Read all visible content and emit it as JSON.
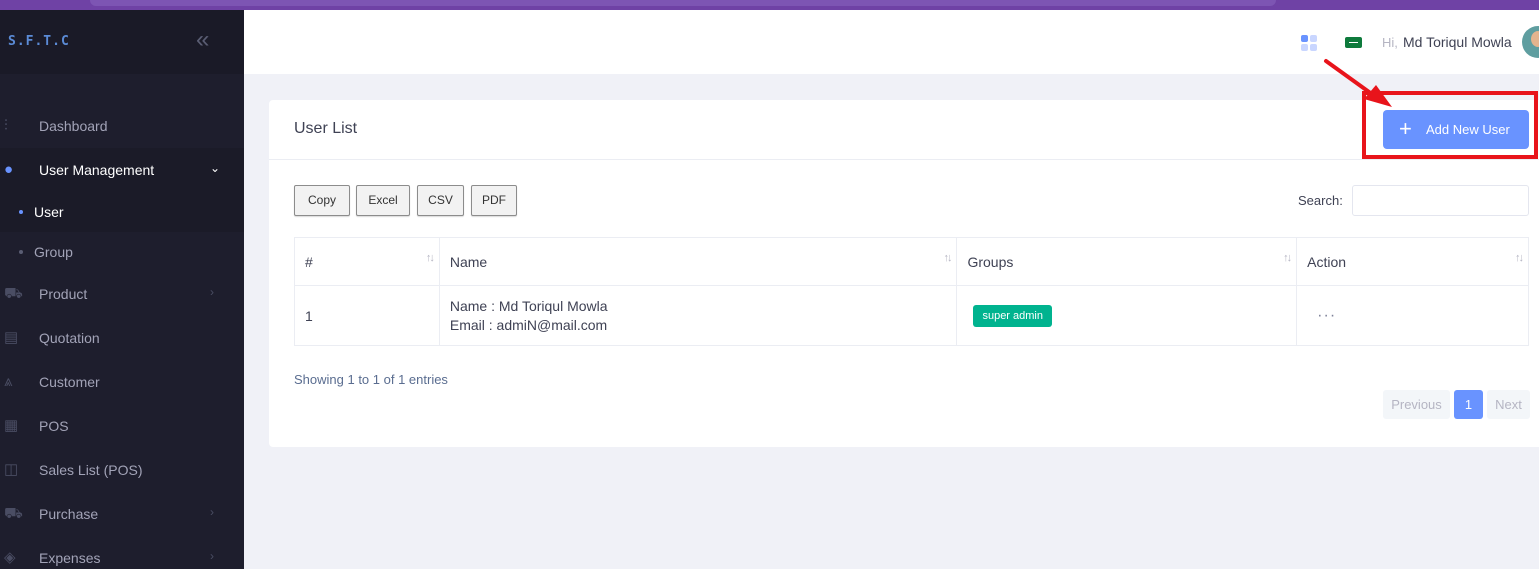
{
  "sidebar": {
    "brand": "S.F.T.C",
    "collapse_icon": "double-chevron-left-icon",
    "items": [
      {
        "label": "Dashboard",
        "icon": "sliders-icon"
      },
      {
        "label": "User Management",
        "icon": "users-icon"
      },
      {
        "label": "Product",
        "icon": "cart-icon"
      },
      {
        "label": "Quotation",
        "icon": "document-icon"
      },
      {
        "label": "Customer",
        "icon": "customer-icon"
      },
      {
        "label": "POS",
        "icon": "grid-icon"
      },
      {
        "label": "Sales List (POS)",
        "icon": "basket-icon"
      },
      {
        "label": "Purchase",
        "icon": "cart-icon"
      },
      {
        "label": "Expenses",
        "icon": "tag-icon"
      }
    ],
    "submenu": [
      {
        "label": "User"
      },
      {
        "label": "Group"
      }
    ]
  },
  "header": {
    "greeting": "Hi,",
    "user_name": "Md Toriqul Mowla"
  },
  "card": {
    "title": "User List",
    "add_button": "Add New User",
    "export_buttons": [
      "Copy",
      "Excel",
      "CSV",
      "PDF"
    ],
    "search_label": "Search:",
    "search_value": "",
    "columns": [
      "#",
      "Name",
      "Groups",
      "Action"
    ],
    "rows": [
      {
        "index": "1",
        "name_line": "Name : Md Toriqul Mowla",
        "email_line": "Email : admiN@mail.com",
        "group": "super admin",
        "action": "···"
      }
    ],
    "info": "Showing 1 to 1 of 1 entries",
    "pagination": {
      "previous": "Previous",
      "page": "1",
      "next": "Next"
    }
  },
  "colors": {
    "accent": "#6993ff",
    "badge": "#00b38f",
    "annotation": "#e8141b"
  }
}
